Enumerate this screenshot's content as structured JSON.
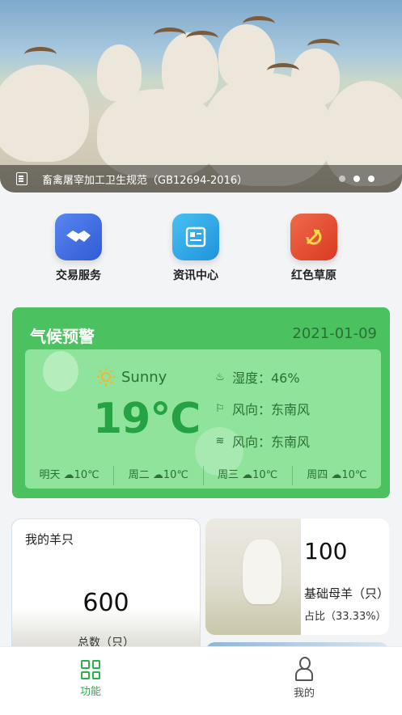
{
  "banner": {
    "caption": "畜禽屠宰加工卫生规范（GB12694-2016）",
    "icon": "document-icon",
    "slides_total": 3,
    "active_slide": 2
  },
  "quick_actions": [
    {
      "label": "交易服务",
      "icon": "handshake-icon",
      "color": "#3f6fe0"
    },
    {
      "label": "资讯中心",
      "icon": "news-icon",
      "color": "#27a6e8"
    },
    {
      "label": "红色草原",
      "icon": "party-emblem-icon",
      "color": "#e34c2f"
    }
  ],
  "weather": {
    "title": "气候预警",
    "date": "2021-01-09",
    "condition": "Sunny",
    "temperature": "19℃",
    "details": [
      {
        "label": "湿度：46%",
        "icon": "humidity-icon"
      },
      {
        "label": "风向：东南风",
        "icon": "wind-vane-icon"
      },
      {
        "label": "风向：东南风",
        "icon": "wind-icon"
      }
    ],
    "forecast": [
      {
        "day": "明天",
        "temp": "10℃"
      },
      {
        "day": "周二",
        "temp": "10℃"
      },
      {
        "day": "周三",
        "temp": "10℃"
      },
      {
        "day": "周四",
        "temp": "10℃"
      }
    ],
    "colors": {
      "card": "#4cc15f",
      "inner": "#8fe39a",
      "temp": "#25a244"
    }
  },
  "stats": {
    "left": {
      "title": "我的羊只",
      "value": "600",
      "label": "总数（只）"
    },
    "right": {
      "value": "100",
      "label": "基础母羊（只）",
      "ratio": "占比（33.33%）"
    }
  },
  "tabbar": {
    "items": [
      {
        "label": "功能",
        "icon": "grid-icon",
        "active": true
      },
      {
        "label": "我的",
        "icon": "user-icon",
        "active": false
      }
    ],
    "accent": "#2db04a"
  }
}
